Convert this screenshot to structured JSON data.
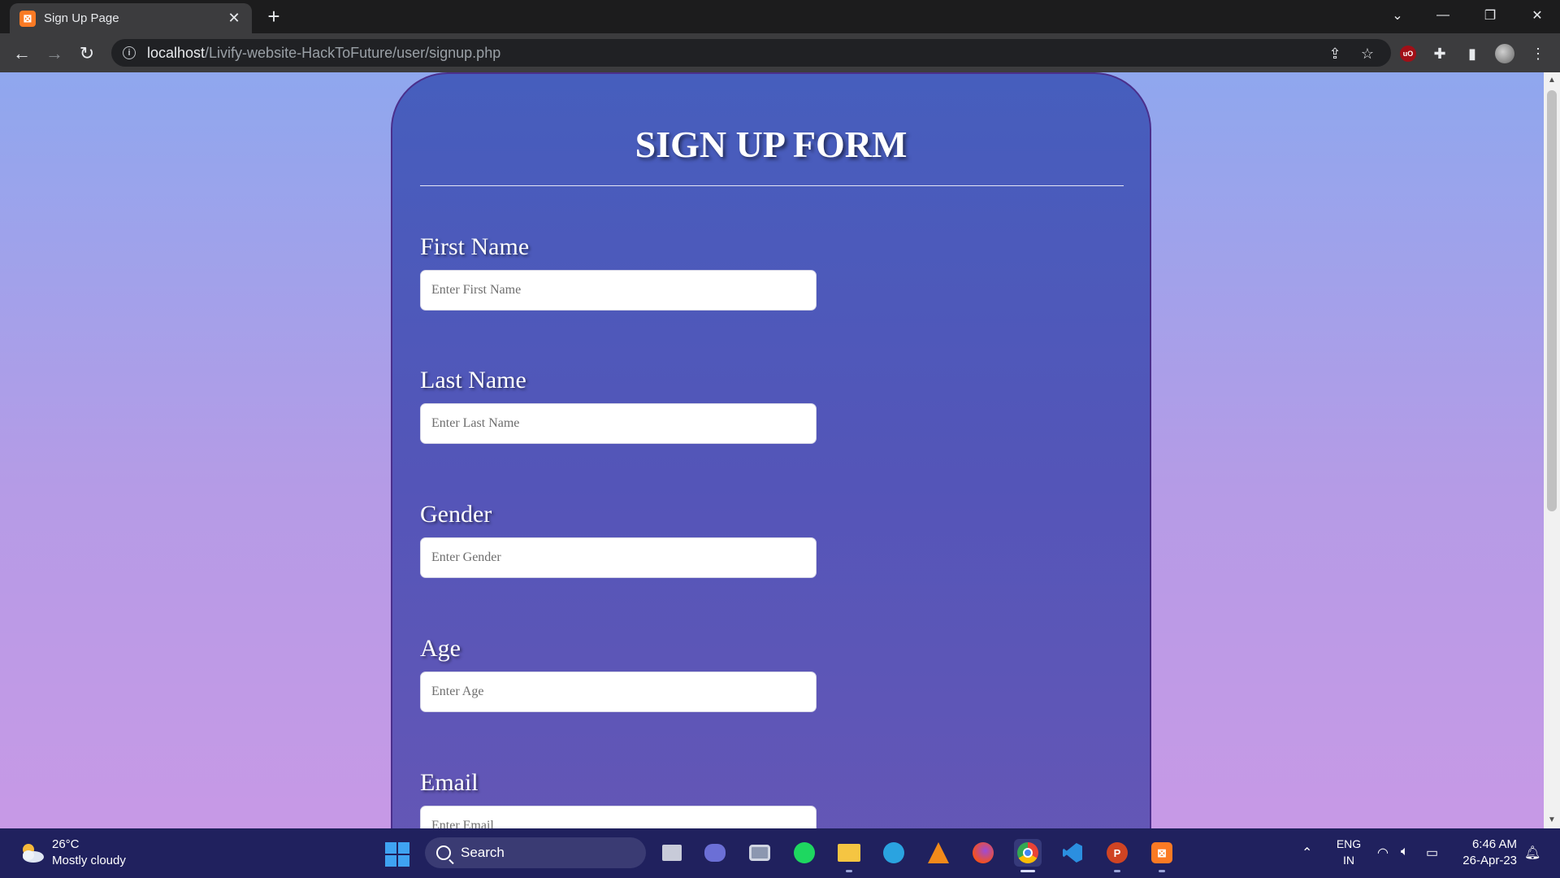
{
  "browser": {
    "tab_title": "Sign Up Page",
    "tab_favicon_text": "⊠",
    "url_host": "localhost",
    "url_path": "/Livify-website-HackToFuture/user/signup.php",
    "extension_badge": "uO"
  },
  "form": {
    "title": "SIGN UP FORM",
    "fields": [
      {
        "label": "First Name",
        "placeholder": "Enter First Name"
      },
      {
        "label": "Last Name",
        "placeholder": "Enter Last Name"
      },
      {
        "label": "Gender",
        "placeholder": "Enter Gender"
      },
      {
        "label": "Age",
        "placeholder": "Enter Age"
      },
      {
        "label": "Email",
        "placeholder": "Enter Email"
      }
    ]
  },
  "taskbar": {
    "weather_temp": "26°C",
    "weather_desc": "Mostly cloudy",
    "search_label": "Search",
    "lang_line1": "ENG",
    "lang_line2": "IN",
    "time": "6:46 AM",
    "date": "26-Apr-23"
  },
  "colors": {
    "page_gradient_top": "#8fa7ee",
    "page_gradient_bottom": "#c799e6",
    "card_top": "#465ebd",
    "card_bottom": "#6657b6",
    "taskbar_bg": "#20215e"
  }
}
